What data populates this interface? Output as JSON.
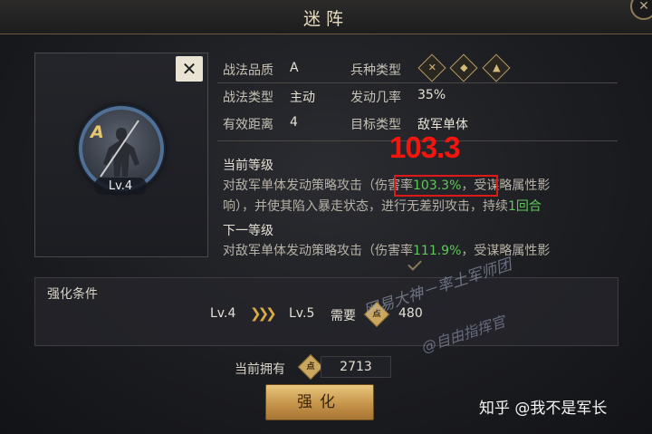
{
  "header": {
    "title": "迷阵",
    "close_glyph": "✕"
  },
  "card": {
    "close_glyph": "✕",
    "grade": "A",
    "level": "Lv.4"
  },
  "stats": {
    "quality_label": "战法品质",
    "quality_value": "A",
    "troop_label": "兵种类型",
    "troop_icons": [
      "crossbow-icon",
      "shield-icon",
      "horse-icon"
    ],
    "type_label": "战法类型",
    "type_value": "主动",
    "rate_label": "发动几率",
    "rate_value": "35%",
    "range_label": "有效距离",
    "range_value": "4",
    "target_label": "目标类型",
    "target_value": "敌军单体"
  },
  "current": {
    "heading": "当前等级",
    "line1_prefix": "对敌军单体发动策略攻击（",
    "rate_word": "伤害率",
    "rate": "103.3%",
    "line1_suffix": "，受谋略属性影",
    "line2_prefix": "响），并使其陷入暴走状态，进行无差别攻击，持续",
    "turns": "1回合"
  },
  "annotation": "103.3",
  "next": {
    "heading": "下一等级",
    "line1_prefix": "对敌军单体发动策略攻击（伤害率",
    "rate": "111.9%",
    "line1_suffix": "，受谋略属性影"
  },
  "condition": {
    "title": "强化条件",
    "from_level": "Lv.4",
    "arrows": "❯❯❯",
    "to_level": "Lv.5",
    "need_label": "需要",
    "need_amount": "480"
  },
  "owned": {
    "label": "当前拥有",
    "amount": "2713"
  },
  "enhance_button": "强化",
  "watermark": {
    "line1": "网易大神－率土军师团",
    "line2": "@自由指挥官"
  },
  "credit": "知乎 @我不是军长",
  "colors": {
    "accent_gold": "#caa75e",
    "highlight_green": "#5ec85b",
    "annotation_red": "#f2160f"
  }
}
